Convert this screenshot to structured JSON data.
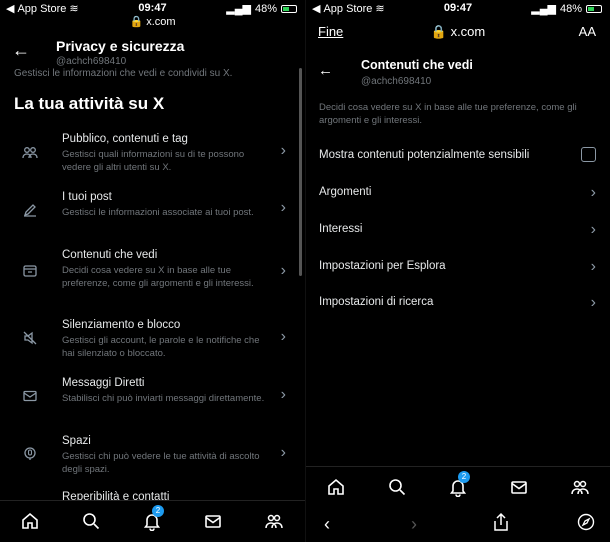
{
  "left": {
    "status": {
      "carrier": "App Store",
      "time": "09:47",
      "battery": "48%",
      "url": "x.com"
    },
    "header": {
      "title": "Privacy e sicurezza",
      "username": "@achch698410",
      "cut_text": "Gestisci le informazioni che vedi e condividi su X."
    },
    "section_title": "La tua attività su X",
    "items": [
      {
        "icon": "people-icon",
        "title": "Pubblico, contenuti e tag",
        "desc": "Gestisci quali informazioni su di te possono vedere gli altri utenti su X."
      },
      {
        "icon": "pencil-icon",
        "title": "I tuoi post",
        "desc": "Gestisci le informazioni associate ai tuoi post."
      },
      {
        "icon": "content-icon",
        "title": "Contenuti che vedi",
        "desc": "Decidi cosa vedere su X in base alle tue preferenze, come gli argomenti e gli interessi."
      },
      {
        "icon": "mute-icon",
        "title": "Silenziamento e blocco",
        "desc": "Gestisci gli account, le parole e le notifiche che hai silenziato o bloccato."
      },
      {
        "icon": "envelope-icon",
        "title": "Messaggi Diretti",
        "desc": "Stabilisci chi può inviarti messaggi direttamente."
      },
      {
        "icon": "microphone-icon",
        "title": "Spazi",
        "desc": "Gestisci chi può vedere le tue attività di ascolto degli spazi."
      },
      {
        "icon": "",
        "title": "Reperibilità e contatti",
        "desc": ""
      }
    ],
    "badge_count": "2"
  },
  "right": {
    "status": {
      "carrier": "App Store",
      "time": "09:47",
      "battery": "48%"
    },
    "browser": {
      "done_label": "Fine",
      "url": "x.com",
      "text_size": "AA"
    },
    "header": {
      "title": "Contenuti che vedi",
      "username": "@achch698410"
    },
    "description": "Decidi cosa vedere su X in base alle tue preferenze, come gli argomenti e gli interessi.",
    "items": [
      {
        "label": "Mostra contenuti potenzialmente sensibili",
        "kind": "checkbox",
        "checked": false
      },
      {
        "label": "Argomenti",
        "kind": "link"
      },
      {
        "label": "Interessi",
        "kind": "link"
      },
      {
        "label": "Impostazioni per Esplora",
        "kind": "link"
      },
      {
        "label": "Impostazioni di ricerca",
        "kind": "link"
      }
    ],
    "badge_count": "2"
  },
  "colors": {
    "accent": "#1d9bf0",
    "muted": "#71767b",
    "text": "#e7e9ea",
    "background": "#000000"
  }
}
